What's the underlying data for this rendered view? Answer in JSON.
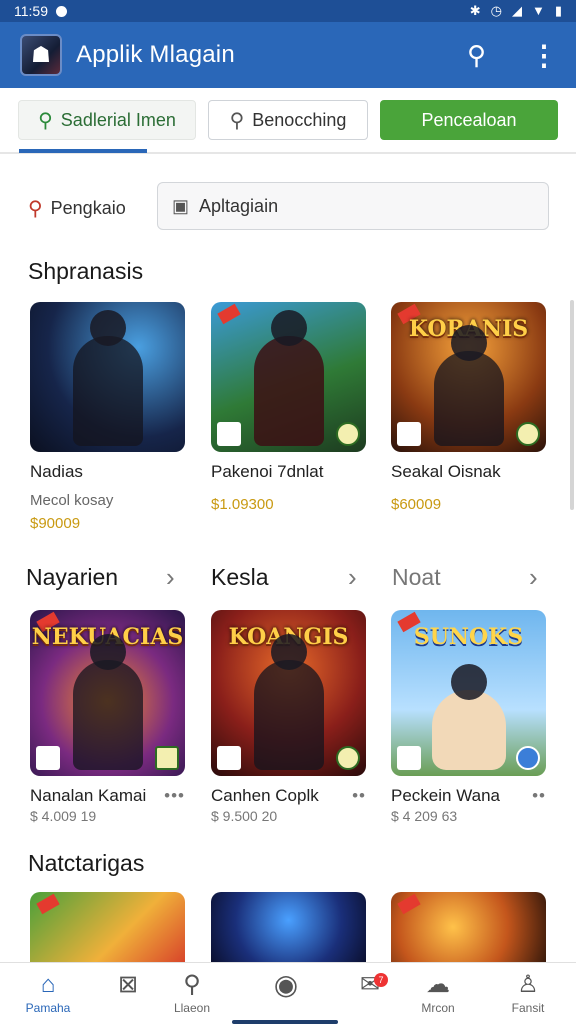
{
  "status": {
    "time": "11:59",
    "icons": [
      "bluetooth-icon",
      "alarm-icon",
      "wifi-icon",
      "signal-icon",
      "battery-icon"
    ]
  },
  "app": {
    "title": "Applik Mlagain"
  },
  "tabs": [
    {
      "label": "Sadlerial Imen"
    },
    {
      "label": "Benocching"
    },
    {
      "label": "Pencealoan"
    }
  ],
  "search": {
    "label": "Pengkaio",
    "placeholder": "Apltagiain"
  },
  "sections": [
    {
      "title": "Shpranasis"
    },
    {
      "title": "Nayarien"
    },
    {
      "title": "Kesla"
    },
    {
      "title": "Noat"
    },
    {
      "title": "Natctarigas"
    }
  ],
  "row1": [
    {
      "name": "Nadias",
      "sub": "Mecol kosay",
      "price": "$90009"
    },
    {
      "name": "Pakenoi 7dnlat",
      "sub": "",
      "price": "$1.09300"
    },
    {
      "name": "Seakal Oisnak",
      "sub": "",
      "price": "$60009"
    }
  ],
  "row2": [
    {
      "name": "Nanalan Kamai",
      "price": "$ 4.009 19",
      "logo": "NEKUACIAS"
    },
    {
      "name": "Canhen Coplk",
      "price": "$ 9.500 20",
      "logo": "KOANGIS"
    },
    {
      "name": "Peckein Wana",
      "price": "$ 4 209 63",
      "logo": "SUNOKS"
    }
  ],
  "row1_logos": [
    "",
    "",
    "KORANIS"
  ],
  "nav": [
    {
      "label": "Pamaha",
      "icon": "home-icon"
    },
    {
      "label": "",
      "icon": "box-icon"
    },
    {
      "label": "Llaeon",
      "icon": "search-icon"
    },
    {
      "label": "",
      "icon": "compass-icon"
    },
    {
      "label": "",
      "icon": "notification-icon",
      "badge": "7"
    },
    {
      "label": "Mrcon",
      "icon": "cloud-icon"
    },
    {
      "label": "Fansit",
      "icon": "profile-icon"
    }
  ],
  "colors": {
    "primary": "#2a67b8",
    "accent_green": "#4aa43a",
    "price_gold": "#c99a12"
  }
}
